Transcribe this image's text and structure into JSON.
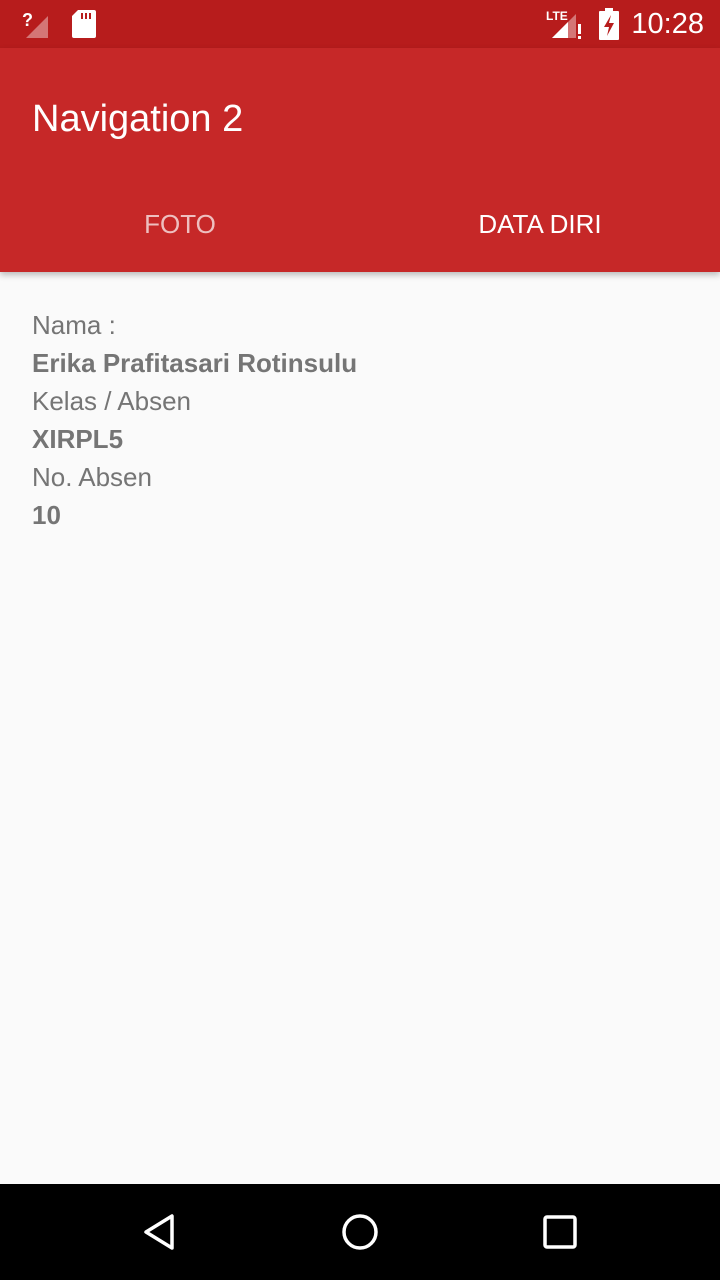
{
  "status_bar": {
    "time": "10:28",
    "network": "LTE",
    "icons": [
      "signal-unknown-icon",
      "sd-card-icon",
      "lte-signal-alert-icon",
      "battery-charging-icon"
    ]
  },
  "app_bar": {
    "title": "Navigation 2",
    "color": "#c62828"
  },
  "tabs": [
    {
      "label": "FOTO",
      "active": false
    },
    {
      "label": "DATA DIRI",
      "active": true
    }
  ],
  "profile": {
    "name_label": "Nama :",
    "name_value": "Erika Prafitasari Rotinsulu",
    "class_label": "Kelas / Absen",
    "class_value": "XIRPL5",
    "number_label": "No. Absen",
    "number_value": "10"
  },
  "nav_bar": {
    "icons": [
      "back-icon",
      "home-icon",
      "recents-icon"
    ]
  }
}
